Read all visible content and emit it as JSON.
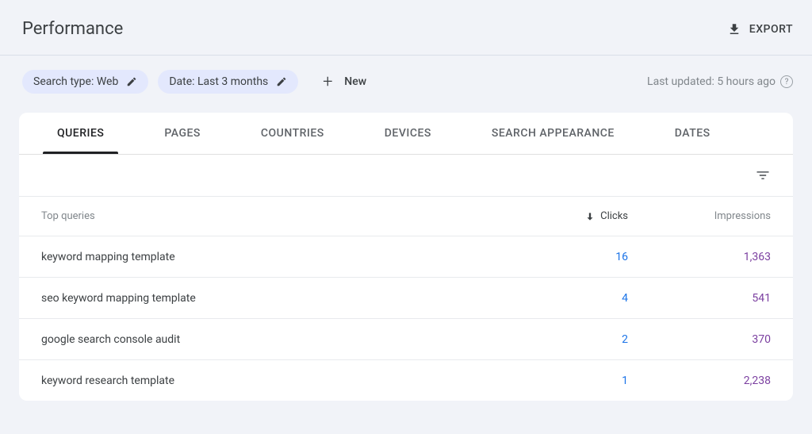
{
  "header": {
    "title": "Performance",
    "export_label": "EXPORT"
  },
  "filters": {
    "search_type": "Search type: Web",
    "date_range": "Date: Last 3 months",
    "new_label": "New",
    "last_updated": "Last updated: 5 hours ago"
  },
  "tabs": [
    {
      "label": "QUERIES",
      "active": true
    },
    {
      "label": "PAGES",
      "active": false
    },
    {
      "label": "COUNTRIES",
      "active": false
    },
    {
      "label": "DEVICES",
      "active": false
    },
    {
      "label": "SEARCH APPEARANCE",
      "active": false
    },
    {
      "label": "DATES",
      "active": false
    }
  ],
  "table": {
    "col_query_header": "Top queries",
    "col_clicks_header": "Clicks",
    "col_impr_header": "Impressions",
    "rows": [
      {
        "query": "keyword mapping template",
        "clicks": "16",
        "impressions": "1,363"
      },
      {
        "query": "seo keyword mapping template",
        "clicks": "4",
        "impressions": "541"
      },
      {
        "query": "google search console audit",
        "clicks": "2",
        "impressions": "370"
      },
      {
        "query": "keyword research template",
        "clicks": "1",
        "impressions": "2,238"
      }
    ]
  }
}
